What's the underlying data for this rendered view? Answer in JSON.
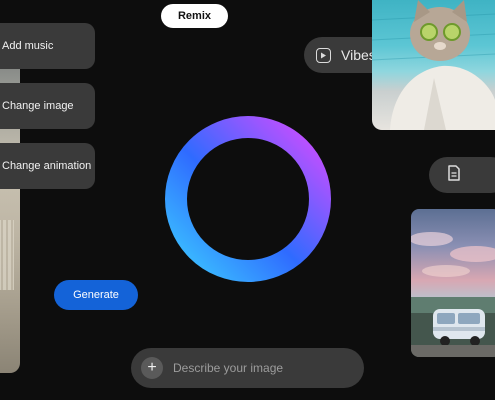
{
  "toolbar": {
    "remix_label": "Remix",
    "vibes_label": "Vibes",
    "doc_icon": "document-icon",
    "play_icon": "play-icon"
  },
  "sidebar": {
    "items": [
      {
        "label": "Add music"
      },
      {
        "label": "Change image"
      },
      {
        "label": "Change animation"
      }
    ]
  },
  "actions": {
    "generate_label": "Generate"
  },
  "prompt": {
    "placeholder": "Describe your image",
    "add_icon": "plus-icon",
    "add_symbol": "+"
  },
  "colors": {
    "accent_blue": "#1463d8",
    "ring_start": "#2f6bff",
    "ring_mid": "#3cc8ff",
    "ring_end": "#d64bff"
  }
}
